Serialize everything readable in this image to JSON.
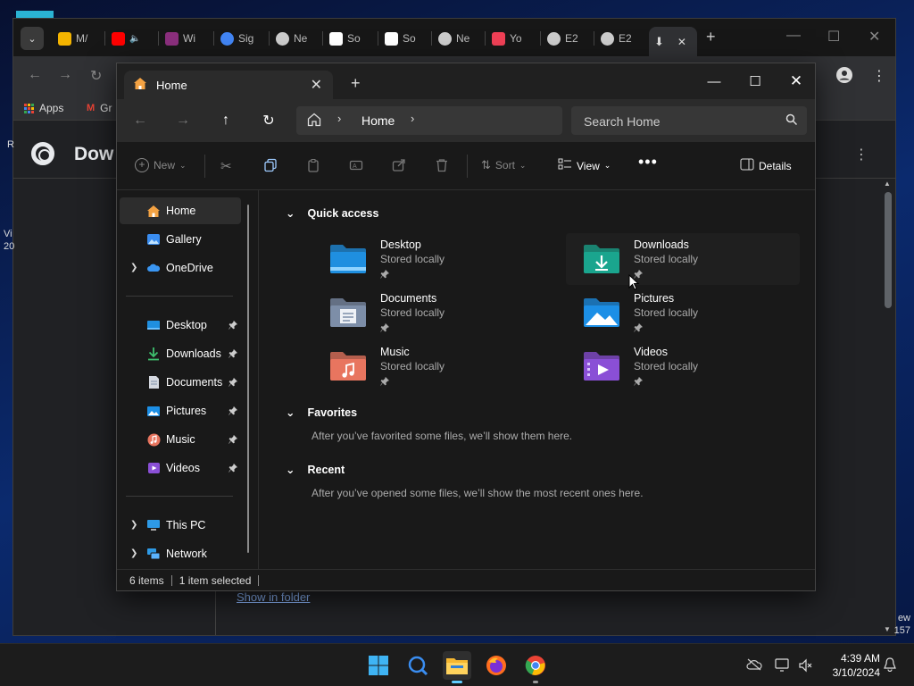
{
  "desktop": {
    "edge_left_1": "R",
    "edge_left_2": "Vi",
    "edge_left_3": "20",
    "edge_right_1": "ew",
    "edge_right_2": "157"
  },
  "chrome": {
    "tabs": [
      {
        "label": "M/",
        "icon": "gmail-icon",
        "color": "#f4b400"
      },
      {
        "label": "",
        "icon": "youtube-audio-icon",
        "color": "#ff0000"
      },
      {
        "label": "Wi",
        "icon": "winrar-icon",
        "color": "#8b2f7d"
      },
      {
        "label": "Sig",
        "icon": "google-icon",
        "color": "#4285f4"
      },
      {
        "label": "Ne",
        "icon": "openai-icon",
        "color": "#cccccc"
      },
      {
        "label": "So",
        "icon": "bank-icon",
        "color": "#ffffff"
      },
      {
        "label": "So",
        "icon": "bank-icon",
        "color": "#ffffff"
      },
      {
        "label": "Ne",
        "icon": "openai-icon",
        "color": "#cccccc"
      },
      {
        "label": "Yo",
        "icon": "pocket-icon",
        "color": "#ef4056"
      },
      {
        "label": "E2",
        "icon": "globe-icon",
        "color": "#cccccc"
      },
      {
        "label": "E2",
        "icon": "globe-icon",
        "color": "#cccccc"
      }
    ],
    "active_tab_close": "✕",
    "new_tab": "+",
    "bookmarks": {
      "apps": "Apps",
      "gmail": "Gr"
    },
    "page_title": "Dow",
    "show_in_folder": "Show in folder"
  },
  "explorer": {
    "tab_title": "Home",
    "address": "Home",
    "search_placeholder": "Search Home",
    "commands": {
      "new": "New",
      "sort": "Sort",
      "view": "View",
      "details": "Details"
    },
    "sidebar": {
      "top": [
        {
          "label": "Home",
          "icon": "home-icon"
        },
        {
          "label": "Gallery",
          "icon": "gallery-icon"
        },
        {
          "label": "OneDrive",
          "icon": "onedrive-icon"
        }
      ],
      "pinned": [
        {
          "label": "Desktop",
          "icon": "desktop-folder-icon"
        },
        {
          "label": "Downloads",
          "icon": "downloads-icon"
        },
        {
          "label": "Documents",
          "icon": "documents-icon"
        },
        {
          "label": "Pictures",
          "icon": "pictures-icon"
        },
        {
          "label": "Music",
          "icon": "music-icon"
        },
        {
          "label": "Videos",
          "icon": "videos-icon"
        }
      ],
      "bottom": [
        {
          "label": "This PC",
          "icon": "this-pc-icon"
        },
        {
          "label": "Network",
          "icon": "network-icon"
        }
      ]
    },
    "quick_access": {
      "heading": "Quick access",
      "items": [
        {
          "name": "Desktop",
          "sub": "Stored locally",
          "icon": "desktop-folder-icon",
          "color": "#1f8fe0"
        },
        {
          "name": "Downloads",
          "sub": "Stored locally",
          "icon": "downloads-folder-icon",
          "color": "#1aa58e"
        },
        {
          "name": "Documents",
          "sub": "Stored locally",
          "icon": "documents-folder-icon",
          "color": "#7d8ea8"
        },
        {
          "name": "Pictures",
          "sub": "Stored locally",
          "icon": "pictures-folder-icon",
          "color": "#1c8fe6"
        },
        {
          "name": "Music",
          "sub": "Stored locally",
          "icon": "music-folder-icon",
          "color": "#e8755f"
        },
        {
          "name": "Videos",
          "sub": "Stored locally",
          "icon": "videos-folder-icon",
          "color": "#8a4fd6"
        }
      ]
    },
    "favorites": {
      "heading": "Favorites",
      "empty": "After you’ve favorited some files, we’ll show them here."
    },
    "recent": {
      "heading": "Recent",
      "empty": "After you’ve opened some files, we’ll show the most recent ones here."
    },
    "status": {
      "count": "6 items",
      "selected": "1 item selected"
    }
  },
  "taskbar": {
    "apps": [
      {
        "icon": "windows-start-icon"
      },
      {
        "icon": "search-icon"
      },
      {
        "icon": "file-explorer-icon"
      },
      {
        "icon": "firefox-icon"
      },
      {
        "icon": "chrome-icon"
      }
    ],
    "time": "4:39 AM",
    "date": "3/10/2024"
  }
}
